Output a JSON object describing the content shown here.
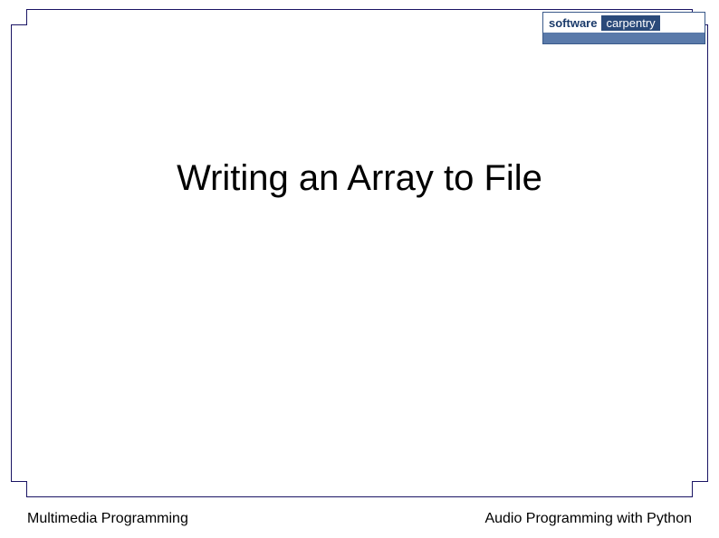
{
  "logo": {
    "word1": "software",
    "word2": "carpentry",
    "tagline_left": "",
    "tagline_right": ""
  },
  "slide": {
    "title": "Writing an Array to File"
  },
  "footer": {
    "left": "Multimedia Programming",
    "right": "Audio Programming with Python"
  }
}
